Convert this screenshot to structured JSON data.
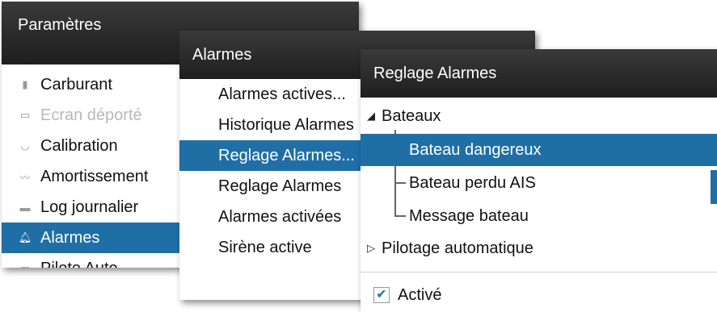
{
  "params_panel": {
    "title": "Paramètres",
    "items": [
      {
        "label": "Carburant",
        "icon": "fuel-icon"
      },
      {
        "label": "Ecran déporté",
        "icon": "screen-icon"
      },
      {
        "label": "Calibration",
        "icon": "calibration-icon"
      },
      {
        "label": "Amortissement",
        "icon": "damping-icon"
      },
      {
        "label": "Log journalier",
        "icon": "log-icon"
      },
      {
        "label": "Alarmes",
        "icon": "bell-icon"
      },
      {
        "label": "Pilote Auto",
        "icon": "autopilot-icon"
      }
    ]
  },
  "alarms_panel": {
    "title": "Alarmes",
    "items": [
      {
        "label": "Alarmes actives..."
      },
      {
        "label": "Historique Alarmes"
      },
      {
        "label": "Reglage Alarmes..."
      },
      {
        "label": "Reglage Alarmes"
      },
      {
        "label": "Alarmes activées"
      },
      {
        "label": "Sirène active"
      }
    ]
  },
  "settings_panel": {
    "title": "Reglage Alarmes",
    "group_boats": "Bateaux",
    "boat_items": [
      {
        "label": "Bateau dangereux"
      },
      {
        "label": "Bateau perdu AIS"
      },
      {
        "label": "Message bateau"
      }
    ],
    "group_autopilot": "Pilotage automatique",
    "enabled_label": "Activé",
    "enabled_checked": true
  },
  "colors": {
    "selection": "#1f6fa6",
    "title_bar": "#2a2a2a"
  }
}
